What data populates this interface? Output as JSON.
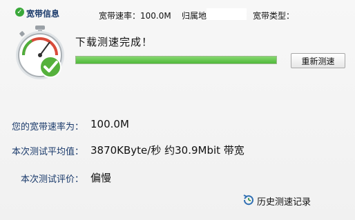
{
  "header": {
    "tab_title": "宽带信息",
    "rate_label": "宽带速率：100.0M",
    "location_label": "归属地",
    "location_value": "",
    "type_label": "宽带类型："
  },
  "status": {
    "message": "下载测速完成！",
    "progress": 1.0,
    "retest_label": "重新测速"
  },
  "results": {
    "rate_label": "您的宽带速率为：",
    "rate_value": "100.0M",
    "avg_label": "本次测试平均值：",
    "avg_value": "3870KByte/秒 约30.9Mbit 带宽",
    "eval_label": "本次测试评价：",
    "eval_value": "偏慢"
  },
  "footer": {
    "history_label": "历史测速记录"
  },
  "colors": {
    "accent": "#1a3a6b",
    "progress": "#4fb83a",
    "check": "#3aa83a"
  },
  "icons": {
    "tab": "check-circle-icon",
    "gauge": "speedometer-icon",
    "history": "refresh-clock-icon"
  }
}
